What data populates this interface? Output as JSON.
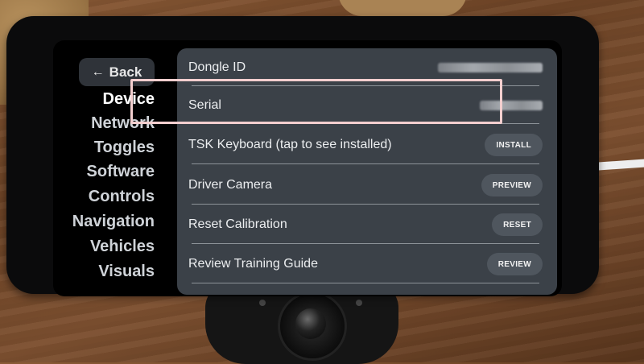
{
  "sidebar": {
    "back_label": "Back",
    "items": [
      {
        "label": "Device",
        "active": true
      },
      {
        "label": "Network",
        "active": false
      },
      {
        "label": "Toggles",
        "active": false
      },
      {
        "label": "Software",
        "active": false
      },
      {
        "label": "Controls",
        "active": false
      },
      {
        "label": "Navigation",
        "active": false
      },
      {
        "label": "Vehicles",
        "active": false
      },
      {
        "label": "Visuals",
        "active": false
      }
    ]
  },
  "device_panel": {
    "rows": [
      {
        "label": "Dongle ID",
        "value_redacted": true
      },
      {
        "label": "Serial",
        "value_redacted": true
      },
      {
        "label": "TSK Keyboard (tap to see installed)",
        "button": "INSTALL",
        "highlighted": true
      },
      {
        "label": "Driver Camera",
        "button": "PREVIEW"
      },
      {
        "label": "Reset Calibration",
        "button": "RESET"
      },
      {
        "label": "Review Training Guide",
        "button": "REVIEW"
      }
    ]
  },
  "colors": {
    "panel_bg": "#3b4148",
    "button_bg": "#4f565e",
    "highlight_border": "#f4cfcf",
    "screen_bg": "#000000"
  },
  "icons": {
    "back": "left-arrow-icon"
  }
}
